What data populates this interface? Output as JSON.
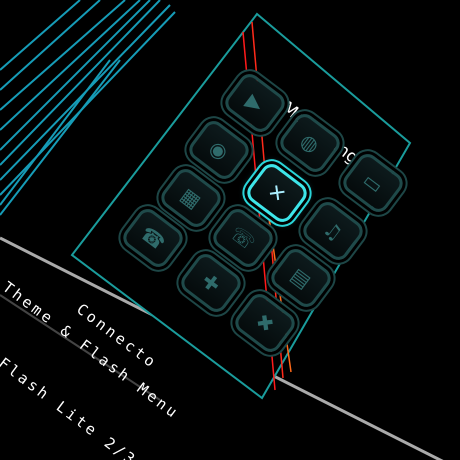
{
  "menu": {
    "selected_title": "Messaging",
    "icons": [
      {
        "name": "media-player-icon",
        "glyph": "▶"
      },
      {
        "name": "camera-icon",
        "glyph": "◉"
      },
      {
        "name": "web-globe-icon",
        "glyph": "◍"
      },
      {
        "name": "messaging-envelope-icon",
        "glyph": "✕"
      },
      {
        "name": "tv-folder-icon",
        "glyph": "▭"
      },
      {
        "name": "calculator-organizer-icon",
        "glyph": "▦"
      },
      {
        "name": "contacts-phone-icon",
        "glyph": "☎"
      },
      {
        "name": "phonebook-icon",
        "glyph": "☏"
      },
      {
        "name": "gallery-icon",
        "glyph": "♫"
      },
      {
        "name": "applications-icon",
        "glyph": "✚"
      },
      {
        "name": "radio-icon",
        "glyph": "▤"
      },
      {
        "name": "settings-tools-icon",
        "glyph": "✖"
      }
    ]
  },
  "caption": {
    "line1": "Connecto",
    "line2": "Theme & Flash Menu",
    "line3": "Flash Lite 2/3"
  },
  "colors": {
    "accent": "#2ad4d8",
    "panel_border": "#1a9c9c",
    "red_line": "#ff1a1a",
    "orange_line": "#ff6a1a"
  }
}
